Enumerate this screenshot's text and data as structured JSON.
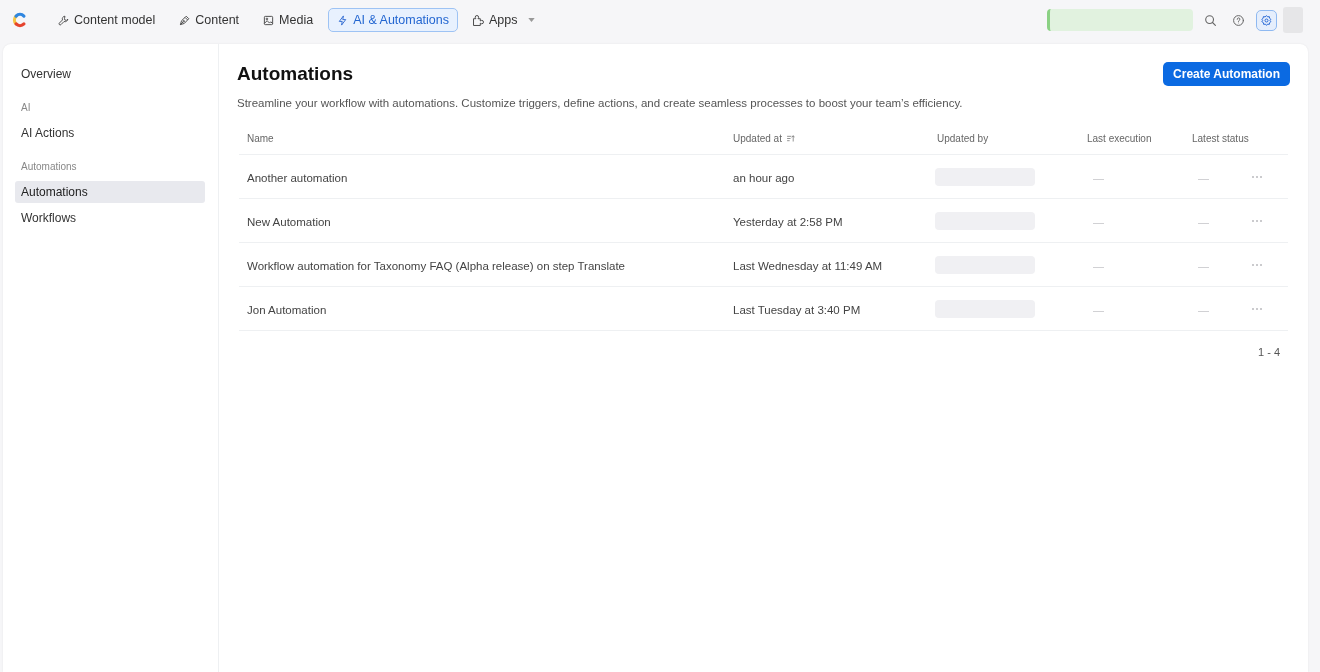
{
  "top_nav": {
    "items": [
      {
        "label": "Content model",
        "kind": "link",
        "selected": false
      },
      {
        "label": "Content",
        "kind": "link",
        "selected": false
      },
      {
        "label": "Media",
        "kind": "link",
        "selected": false
      },
      {
        "label": "AI & Automations",
        "kind": "link",
        "selected": true
      },
      {
        "label": "Apps",
        "kind": "menu",
        "selected": false
      }
    ]
  },
  "sidebar": {
    "items": [
      {
        "kind": "link",
        "label": "Overview",
        "selected": false
      },
      {
        "kind": "section",
        "label": "AI"
      },
      {
        "kind": "link",
        "label": "AI Actions",
        "selected": false
      },
      {
        "kind": "section",
        "label": "Automations"
      },
      {
        "kind": "link",
        "label": "Automations",
        "selected": true
      },
      {
        "kind": "link",
        "label": "Workflows",
        "selected": false
      }
    ]
  },
  "page": {
    "title": "Automations",
    "description": "Streamline your workflow with automations. Customize triggers, define actions, and create seamless processes to boost your team’s efficiency.",
    "primary_button": "Create Automation"
  },
  "table": {
    "columns": [
      {
        "label": "Name",
        "sorted": false
      },
      {
        "label": "Updated at",
        "sorted": true
      },
      {
        "label": "Updated by",
        "sorted": false
      },
      {
        "label": "Last execution",
        "sorted": false
      },
      {
        "label": "Latest status",
        "sorted": false
      }
    ],
    "rows": [
      {
        "name": "Another automation",
        "updated_at": "an hour ago",
        "last_execution": "—",
        "latest_status": "—"
      },
      {
        "name": "New Automation",
        "updated_at": "Yesterday at 2:58 PM",
        "last_execution": "—",
        "latest_status": "—"
      },
      {
        "name": "Workflow automation for Taxonomy FAQ (Alpha release) on step Translate",
        "updated_at": "Last Wednesday at 11:49 AM",
        "last_execution": "—",
        "latest_status": "—"
      },
      {
        "name": "Jon Automation",
        "updated_at": "Last Tuesday at 3:40 PM",
        "last_execution": "—",
        "latest_status": "—"
      }
    ],
    "pagination": "1 - 4"
  }
}
